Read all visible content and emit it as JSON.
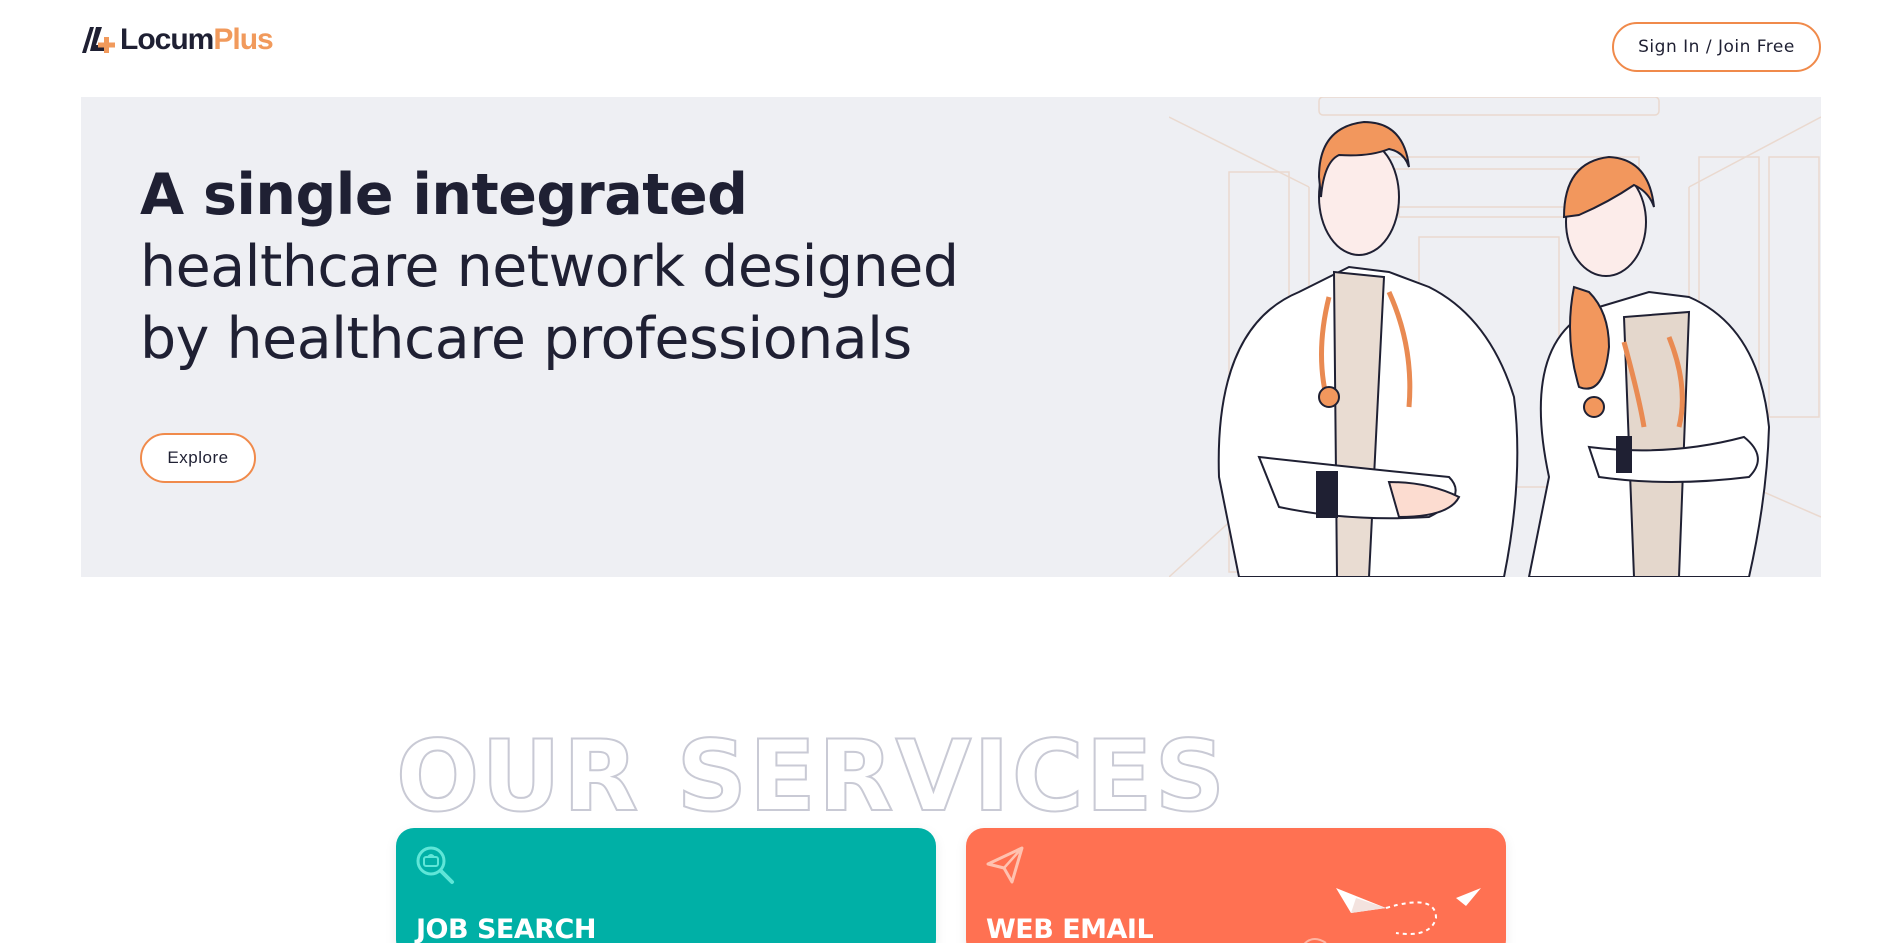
{
  "brand": {
    "name_part1": "Locum",
    "name_part2": "Plus",
    "accent_color": "#f19a5c",
    "dark_color": "#1f2033"
  },
  "header": {
    "signin_label": "Sign In / Join Free"
  },
  "hero": {
    "title_bold": "A single integrated",
    "title_line2": "healthcare network designed",
    "title_line3": "by healthcare professionals",
    "explore_label": "Explore",
    "illustration": "two-doctors-illustration"
  },
  "services": {
    "heading": "OUR SERVICES",
    "cards": [
      {
        "title": "JOB SEARCH",
        "icon": "job-search-icon",
        "color": "#00b0a6"
      },
      {
        "title": "WEB EMAIL",
        "icon": "paper-plane-icon",
        "color": "#ff7152"
      }
    ]
  }
}
